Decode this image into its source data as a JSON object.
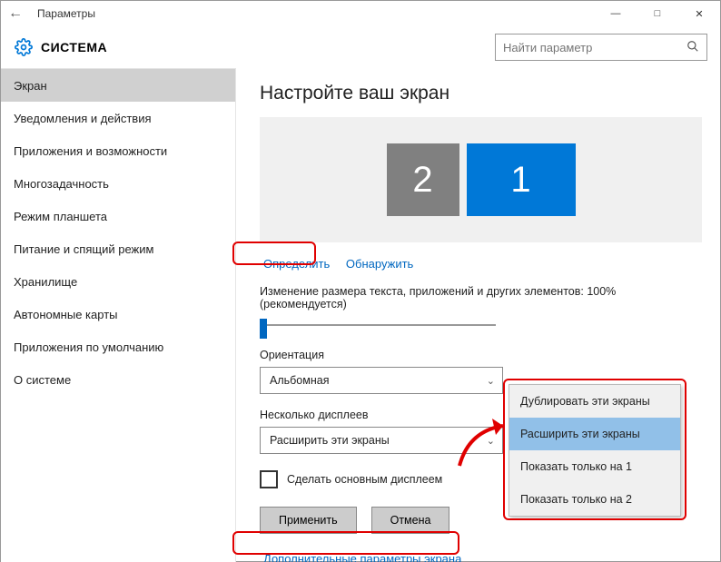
{
  "window": {
    "title": "Параметры"
  },
  "header": {
    "title": "СИСТЕМА"
  },
  "search": {
    "placeholder": "Найти параметр"
  },
  "sidebar": {
    "items": [
      "Экран",
      "Уведомления и действия",
      "Приложения и возможности",
      "Многозадачность",
      "Режим планшета",
      "Питание и спящий режим",
      "Хранилище",
      "Автономные карты",
      "Приложения по умолчанию",
      "О системе"
    ],
    "selected_index": 0
  },
  "page": {
    "title": "Настройте ваш экран",
    "monitors": {
      "left": "2",
      "right": "1"
    },
    "links": {
      "identify": "Определить",
      "detect": "Обнаружить"
    },
    "scaling_label": "Изменение размера текста, приложений и других элементов: 100% (рекомендуется)",
    "orientation": {
      "label": "Ориентация",
      "value": "Альбомная"
    },
    "multi": {
      "label": "Несколько дисплеев",
      "value": "Расширить эти экраны"
    },
    "checkbox_label": "Сделать основным дисплеем",
    "buttons": {
      "apply": "Применить",
      "cancel": "Отмена"
    },
    "adv_link": "Дополнительные параметры экрана"
  },
  "dropdown": {
    "items": [
      "Дублировать эти экраны",
      "Расширить эти экраны",
      "Показать только на 1",
      "Показать только на 2"
    ],
    "selected_index": 1
  }
}
